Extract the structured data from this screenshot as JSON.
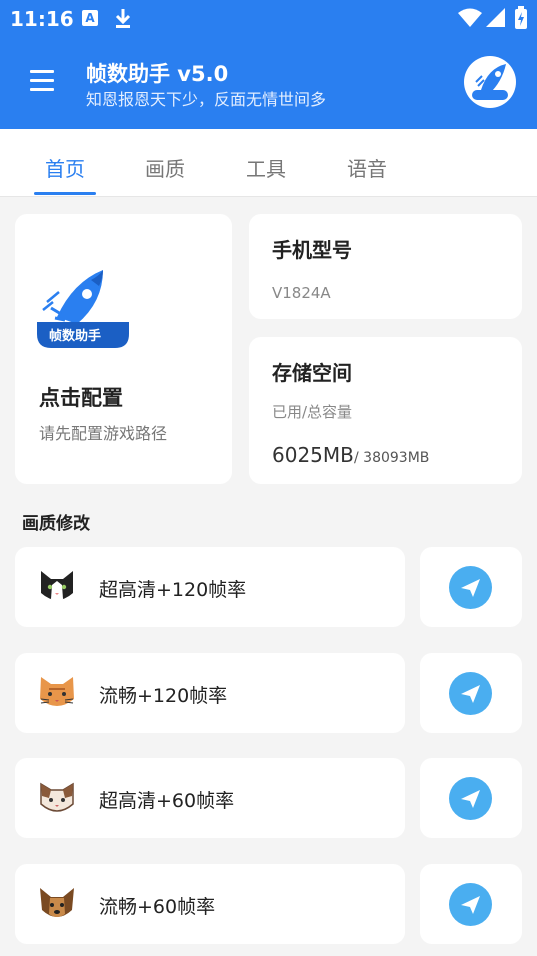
{
  "status_bar": {
    "time": "11:16",
    "notif_icon_letter": "A"
  },
  "header": {
    "title": "帧数助手 v5.0",
    "subtitle": "知恩报恩天下少，反面无情世间多"
  },
  "tabs": [
    {
      "label": "首页",
      "active": true
    },
    {
      "label": "画质",
      "active": false
    },
    {
      "label": "工具",
      "active": false
    },
    {
      "label": "语音",
      "active": false
    }
  ],
  "config_card": {
    "title": "点击配置",
    "subtitle": "请先配置游戏路径",
    "logo_text": "帧数助手"
  },
  "model_card": {
    "title": "手机型号",
    "value": "V1824A"
  },
  "storage_card": {
    "title": "存储空间",
    "subtitle": "已用/总容量",
    "used": "6025MB",
    "total": "/ 38093MB"
  },
  "quality_section": {
    "title": "画质修改",
    "items": [
      {
        "label": "超高清+120帧率",
        "icon": "tuxedo-cat-icon"
      },
      {
        "label": "流畅+120帧率",
        "icon": "orange-cat-icon"
      },
      {
        "label": "超高清+60帧率",
        "icon": "calico-cat-icon"
      },
      {
        "label": "流畅+60帧率",
        "icon": "yorkie-dog-icon"
      }
    ]
  },
  "colors": {
    "primary": "#2a7ff0",
    "send_button": "#4aaef0",
    "background": "#f4f4f4"
  }
}
